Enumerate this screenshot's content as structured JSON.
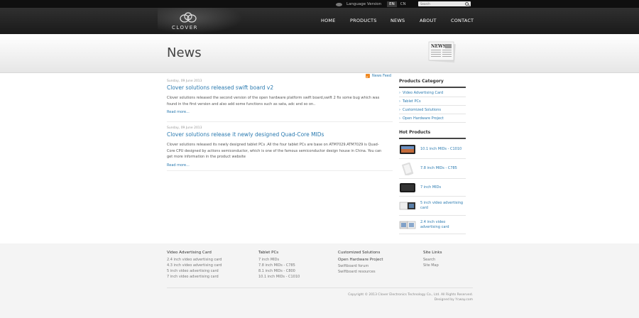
{
  "topbar": {
    "language_label": "Language Version",
    "lang_en": "EN",
    "lang_cn": "CN",
    "search_placeholder": "Search"
  },
  "header": {
    "logo_text": "CLOVER",
    "nav": [
      "HOME",
      "PRODUCTS",
      "NEWS",
      "ABOUT",
      "CONTACT"
    ]
  },
  "page": {
    "title": "News",
    "news_feed": "News Feed"
  },
  "posts": [
    {
      "date": "Sunday, 09 June 2013",
      "title": "Clover solutions released swift board v2",
      "body_lines": [
        "Clover solutions released the second version of the open hardware platform swift board,swift 2 fix some bug which was",
        "found in the first version and also add some functions such as sata,  adc and so on.."
      ],
      "more": "Read more..."
    },
    {
      "date": "Sunday, 09 June 2013",
      "title": "Clover solutions release it newly designed Quad-Core MIDs",
      "body_lines": [
        "Clover solutions released its newly designed tablet PCs .All the four tablet PCs are base on ATM7029.ATM7029 is Quad-",
        "Core CPU designed by actions semiconductor, which is one of the famous semiconductor design house in China. You can",
        "get more information in the product website"
      ],
      "more": "Read more..."
    }
  ],
  "sidebar": {
    "categories_title": "Products Category",
    "categories": [
      "Video Advertising Card",
      "Tablet PCs",
      "Customized Solutions",
      "Open Hardware Project"
    ],
    "hot_title": "Hot Products",
    "hot": [
      {
        "name_lines": [
          "10.1 inch MIDs - C1010"
        ]
      },
      {
        "name_lines": [
          "7.8 inch MIDs - C785"
        ]
      },
      {
        "name_lines": [
          "7 inch MIDs"
        ]
      },
      {
        "name_lines": [
          "5 inch video advertising",
          "card"
        ]
      },
      {
        "name_lines": [
          "2.4 inch video",
          "advertising card"
        ]
      }
    ]
  },
  "footer": {
    "columns": [
      {
        "title": "Video Advertising Card",
        "items": [
          "2.4 inch video advertising card",
          "4.3 inch video advertising card",
          "5 inch video advertising card",
          "7 inch video advertising card"
        ]
      },
      {
        "title": "Tablet PCs",
        "items": [
          "7 inch MIDs",
          "7.8 inch MIDs - C785",
          "8.1 inch MIDs - C800",
          "10.1 inch MIDs - C1010"
        ]
      },
      {
        "title": "Customized Solutions",
        "subtitle": "Open Hardware Project",
        "items": [
          "Swiftboard forum",
          "Swiftboard resources"
        ]
      },
      {
        "title": "Site Links",
        "items": [
          "Search",
          "Site Map"
        ]
      }
    ],
    "copyright": "Copyright © 2013 Clover Electronics Technology Co., Ltd. All Rights Reserved.",
    "designed_by": "Designed by Ycway.com"
  },
  "colors": {
    "link": "#2a7ab0",
    "header_dark": "#1a1a1a",
    "rss": "#f08a24"
  }
}
